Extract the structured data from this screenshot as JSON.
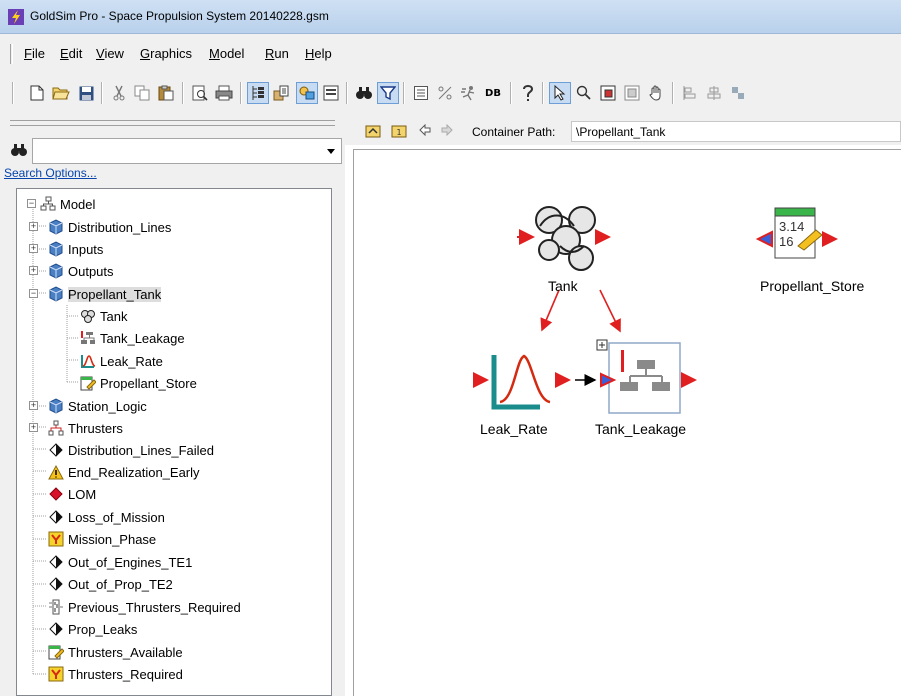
{
  "window": {
    "title": "GoldSim Pro - Space Propulsion System 20140228.gsm",
    "app_icon": "goldsim-app-icon"
  },
  "menu": {
    "items": [
      "File",
      "Edit",
      "View",
      "Graphics",
      "Model",
      "Run",
      "Help"
    ]
  },
  "toolbar": {
    "db_label": "DB"
  },
  "search": {
    "value": "",
    "options_link": "Search Options..."
  },
  "tree": {
    "root": "Model",
    "items": [
      {
        "label": "Distribution_Lines",
        "icon": "container-icon"
      },
      {
        "label": "Inputs",
        "icon": "container-icon"
      },
      {
        "label": "Outputs",
        "icon": "container-icon"
      },
      {
        "label": "Propellant_Tank",
        "icon": "container-icon",
        "selected": true,
        "children": [
          "Tank",
          "Tank_Leakage",
          "Leak_Rate",
          "Propellant_Store"
        ]
      },
      {
        "label": "Station_Logic",
        "icon": "container-icon"
      },
      {
        "label": "Thrusters",
        "icon": "subsystem-icon"
      },
      {
        "label": "Distribution_Lines_Failed",
        "icon": "milestone-icon"
      },
      {
        "label": "End_Realization_Early",
        "icon": "warning-icon"
      },
      {
        "label": "LOM",
        "icon": "red-diamond-icon"
      },
      {
        "label": "Loss_of_Mission",
        "icon": "milestone-icon"
      },
      {
        "label": "Mission_Phase",
        "icon": "status-icon"
      },
      {
        "label": "Out_of_Engines_TE1",
        "icon": "milestone-icon"
      },
      {
        "label": "Out_of_Prop_TE2",
        "icon": "milestone-icon"
      },
      {
        "label": "Previous_Thrusters_Required",
        "icon": "history-icon"
      },
      {
        "label": "Prop_Leaks",
        "icon": "milestone-icon"
      },
      {
        "label": "Thrusters_Available",
        "icon": "data-icon"
      },
      {
        "label": "Thrusters_Required",
        "icon": "status-icon"
      }
    ]
  },
  "pathbar": {
    "label": "Container Path:",
    "path": "\\Propellant_Tank"
  },
  "canvas": {
    "nodes": {
      "tank": "Tank",
      "propellant_store": "Propellant_Store",
      "leak_rate": "Leak_Rate",
      "tank_leakage": "Tank_Leakage"
    },
    "store_value_top": "3.14",
    "store_value_bottom": "16"
  },
  "colors": {
    "link_red": "#e02020",
    "bar_teal": "#1a8c8c",
    "curve_red": "#d42a10",
    "selection_blue": "#6d9fd6"
  }
}
